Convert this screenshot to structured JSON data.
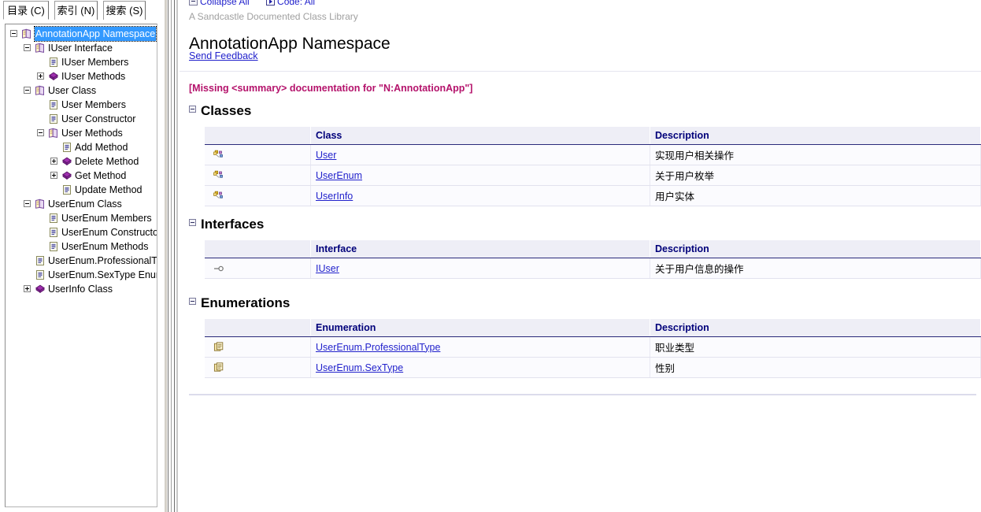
{
  "left_pane": {
    "tabs": [
      {
        "label": "目录 (C)",
        "selected": true,
        "name": "tab-contents"
      },
      {
        "label": "索引 (N)",
        "selected": false,
        "name": "tab-index"
      },
      {
        "label": "搜索 (S)",
        "selected": false,
        "name": "tab-search"
      }
    ],
    "tree": [
      {
        "label": "AnnotationApp Namespace",
        "depth": 0,
        "icon": "book-icon",
        "toggle": "minus",
        "selected": true
      },
      {
        "label": "IUser Interface",
        "depth": 1,
        "icon": "book-icon",
        "toggle": "minus",
        "selected": false
      },
      {
        "label": "IUser Members",
        "depth": 2,
        "icon": "page-icon",
        "toggle": "none",
        "selected": false
      },
      {
        "label": "IUser Methods",
        "depth": 2,
        "icon": "diamond-icon",
        "toggle": "plus",
        "selected": false
      },
      {
        "label": "User Class",
        "depth": 1,
        "icon": "book-icon",
        "toggle": "minus",
        "selected": false
      },
      {
        "label": "User Members",
        "depth": 2,
        "icon": "page-icon",
        "toggle": "none",
        "selected": false
      },
      {
        "label": "User Constructor",
        "depth": 2,
        "icon": "page-icon",
        "toggle": "none",
        "selected": false
      },
      {
        "label": "User Methods",
        "depth": 2,
        "icon": "book-icon",
        "toggle": "minus",
        "selected": false
      },
      {
        "label": "Add Method",
        "depth": 3,
        "icon": "page-icon",
        "toggle": "none",
        "selected": false
      },
      {
        "label": "Delete Method",
        "depth": 3,
        "icon": "diamond-icon",
        "toggle": "plus",
        "selected": false
      },
      {
        "label": "Get Method",
        "depth": 3,
        "icon": "diamond-icon",
        "toggle": "plus",
        "selected": false
      },
      {
        "label": "Update Method",
        "depth": 3,
        "icon": "page-icon",
        "toggle": "none",
        "selected": false
      },
      {
        "label": "UserEnum Class",
        "depth": 1,
        "icon": "book-icon",
        "toggle": "minus",
        "selected": false
      },
      {
        "label": "UserEnum Members",
        "depth": 2,
        "icon": "page-icon",
        "toggle": "none",
        "selected": false
      },
      {
        "label": "UserEnum Constructor",
        "depth": 2,
        "icon": "page-icon",
        "toggle": "none",
        "selected": false
      },
      {
        "label": "UserEnum Methods",
        "depth": 2,
        "icon": "page-icon",
        "toggle": "none",
        "selected": false
      },
      {
        "label": "UserEnum.ProfessionalType Enumeration",
        "depth": 1,
        "icon": "page-icon",
        "toggle": "none",
        "selected": false
      },
      {
        "label": "UserEnum.SexType Enumeration",
        "depth": 1,
        "icon": "page-icon",
        "toggle": "none",
        "selected": false
      },
      {
        "label": "UserInfo Class",
        "depth": 1,
        "icon": "diamond-icon",
        "toggle": "plus",
        "selected": false
      }
    ]
  },
  "content": {
    "toolbar": {
      "collapse_all": "Collapse All",
      "code": "Code: All"
    },
    "subtitle": "A Sandcastle Documented Class Library",
    "title": "AnnotationApp Namespace",
    "feedback": "Send Feedback",
    "missing_summary": "[Missing <summary> documentation for \"N:AnnotationApp\"]",
    "sections": [
      {
        "heading": "Classes",
        "columns": [
          "",
          "Class",
          "Description"
        ],
        "rows": [
          {
            "icon": "class-icon",
            "name": "User",
            "description": "实现用户相关操作"
          },
          {
            "icon": "class-icon",
            "name": "UserEnum",
            "description": "关于用户枚举"
          },
          {
            "icon": "class-icon",
            "name": "UserInfo",
            "description": "用户实体"
          }
        ]
      },
      {
        "heading": "Interfaces",
        "columns": [
          "",
          "Interface",
          "Description"
        ],
        "rows": [
          {
            "icon": "interface-icon",
            "name": "IUser",
            "description": "关于用户信息的操作"
          }
        ]
      },
      {
        "heading": "Enumerations",
        "columns": [
          "",
          "Enumeration",
          "Description"
        ],
        "rows": [
          {
            "icon": "enumeration-icon",
            "name": "UserEnum.ProfessionalType",
            "description": "职业类型"
          },
          {
            "icon": "enumeration-icon",
            "name": "UserEnum.SexType",
            "description": "性别"
          }
        ]
      }
    ]
  },
  "colors": {
    "link": "#2222cc",
    "missing": "#b4126b",
    "header_text": "#00007a",
    "header_bg": "#eeeef6",
    "selection": "#3399ff"
  }
}
